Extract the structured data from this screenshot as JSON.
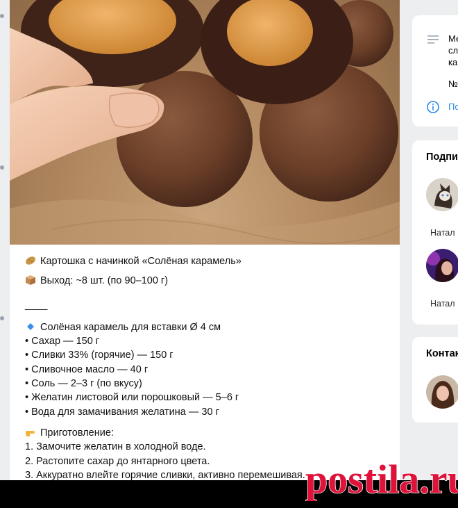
{
  "post": {
    "title_line": "Картошка с начинкой «Солёная карамель»",
    "yield_line": "Выход: ~8 шт. (по 90–100 г)",
    "divider": "____",
    "caramel_heading": "Солёная карамель для вставки Ø 4 см",
    "ingredients": [
      "• Сахар — 150 г",
      "• Сливки 33% (горячие) — 150 г",
      "• Сливочное масло — 40 г",
      "• Соль — 2–3 г (по вкусу)",
      "• Желатин листовой или порошковый — 5–6 г",
      "• Вода для замачивания желатина — 30 г"
    ],
    "steps_heading": "Приготовление:",
    "steps": [
      "1. Замочите желатин в холодной воде.",
      "2. Растопите сахар до янтарного цвета.",
      "3. Аккуратно влейте горячие сливки, активно перемешивая."
    ]
  },
  "sidebar": {
    "about": {
      "lines": [
        "Ме",
        "сл",
        "ка"
      ],
      "number_prefix": "№",
      "more_label": "По"
    },
    "subscribers": {
      "title": "Подпи",
      "members": [
        {
          "name": "Натал"
        },
        {
          "name": "Натал"
        }
      ]
    },
    "contacts": {
      "title": "Контак"
    }
  },
  "watermark": {
    "text": "postila.ru",
    "color": "#e0123a"
  },
  "icons": {
    "list": "menu-lines-icon",
    "info": "info-circle-icon",
    "potato": "potato-emoji-icon",
    "box": "package-emoji-icon",
    "diamond": "blue-diamond-emoji-icon",
    "hand": "pointing-hand-emoji-icon"
  }
}
